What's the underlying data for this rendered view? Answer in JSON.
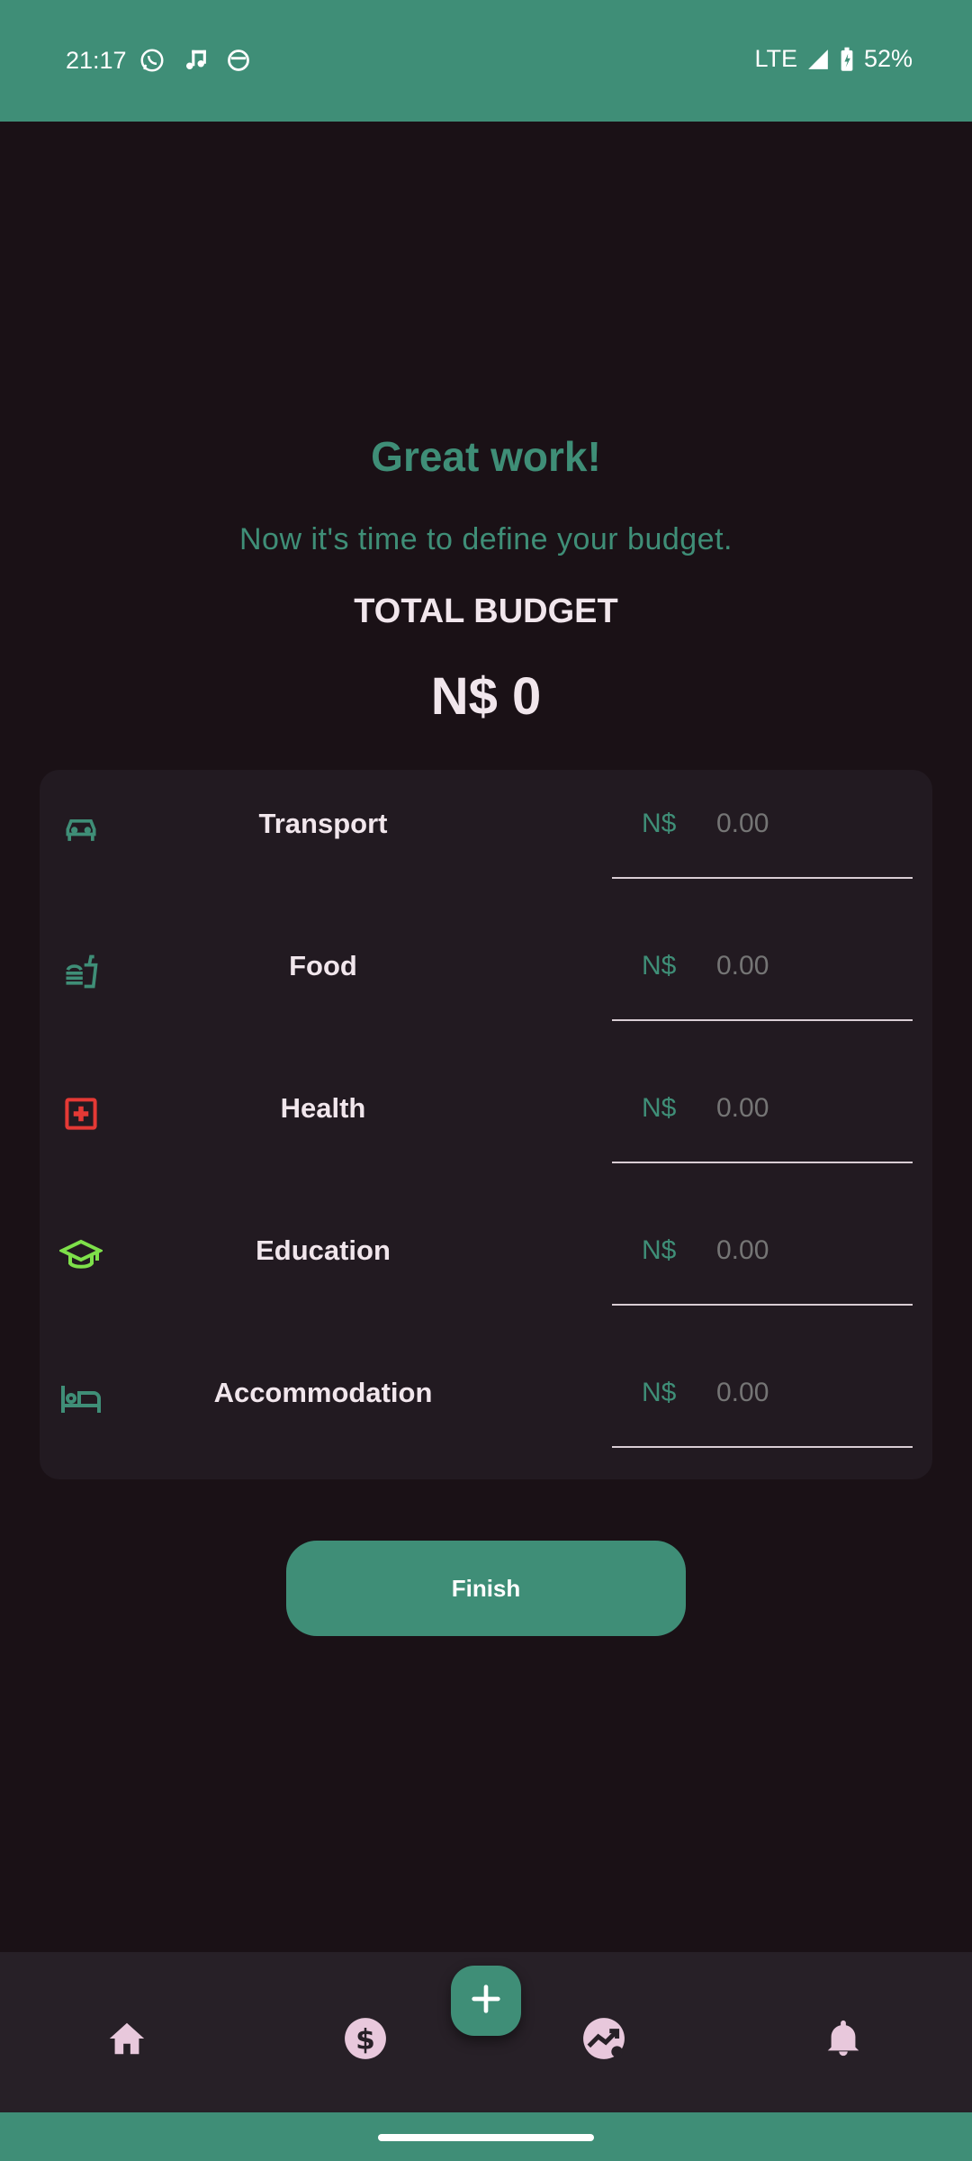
{
  "status_bar": {
    "time": "21:17",
    "network": "LTE",
    "battery": "52%",
    "notification_icons": [
      "whatsapp-icon",
      "music-icon",
      "face-icon"
    ]
  },
  "header": {
    "title": "Great work!",
    "subtitle": "Now it's time to define your budget.",
    "total_label": "TOTAL BUDGET",
    "total_value": "N$ 0"
  },
  "categories": [
    {
      "label": "Transport",
      "currency": "N$",
      "amount": "0.00",
      "icon": "car-icon",
      "icon_color": "#3f8e77"
    },
    {
      "label": "Food",
      "currency": "N$",
      "amount": "0.00",
      "icon": "fastfood-icon",
      "icon_color": "#3f8e77"
    },
    {
      "label": "Health",
      "currency": "N$",
      "amount": "0.00",
      "icon": "medical-icon",
      "icon_color": "#e53935"
    },
    {
      "label": "Education",
      "currency": "N$",
      "amount": "0.00",
      "icon": "graduation-cap-icon",
      "icon_color": "#7ee04a"
    },
    {
      "label": "Accommodation",
      "currency": "N$",
      "amount": "0.00",
      "icon": "bed-icon",
      "icon_color": "#3f8e77"
    }
  ],
  "actions": {
    "finish_label": "Finish"
  },
  "bottom_nav": {
    "items": [
      "home-icon",
      "dollar-icon",
      "add-icon",
      "chart-icon",
      "bell-icon"
    ]
  },
  "colors": {
    "accent": "#3f8e77",
    "background": "#1a1116",
    "card": "#221a21",
    "nav_icon": "#e8c8dc"
  }
}
